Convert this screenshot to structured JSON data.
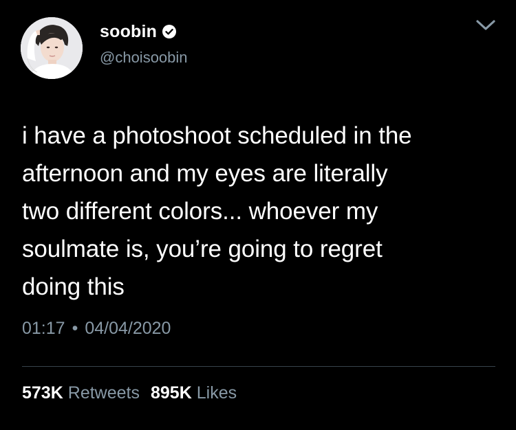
{
  "user": {
    "display_name": "soobin",
    "handle": "@choisoobin",
    "verified": true,
    "avatar_icon": "avatar-photo-icon"
  },
  "tweet": {
    "text": "i have a photoshoot scheduled in the\nafternoon and my eyes are literally\ntwo different colors... whoever my\nsoulmate is, you’re going to regret\ndoing this",
    "time": "01:17",
    "separator": "•",
    "date": "04/04/2020"
  },
  "stats": {
    "retweets_count": "573K",
    "retweets_label": "Retweets",
    "likes_count": "895K",
    "likes_label": "Likes"
  },
  "icons": {
    "verified": "verified-badge-icon",
    "menu": "chevron-down-icon"
  },
  "colors": {
    "background": "#000000",
    "text": "#ffffff",
    "secondary_text": "#8899a6",
    "divider": "#38444d"
  }
}
